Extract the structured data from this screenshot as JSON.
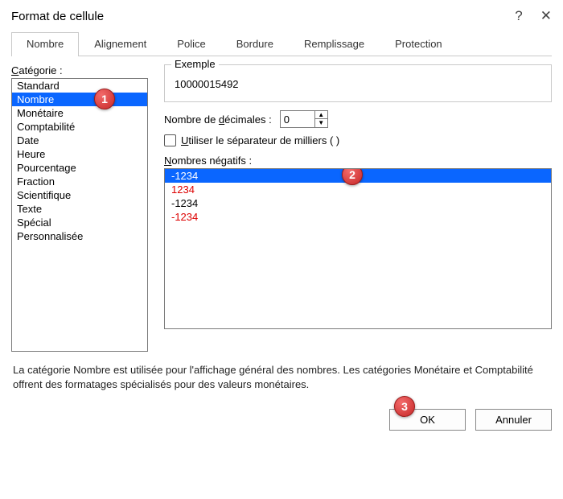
{
  "title": "Format de cellule",
  "tabs": [
    "Nombre",
    "Alignement",
    "Police",
    "Bordure",
    "Remplissage",
    "Protection"
  ],
  "activeTabIndex": 0,
  "left": {
    "label_pre": "",
    "label_underline": "C",
    "label_post": "atégorie :",
    "items": [
      "Standard",
      "Nombre",
      "Monétaire",
      "Comptabilité",
      "Date",
      "Heure",
      "Pourcentage",
      "Fraction",
      "Scientifique",
      "Texte",
      "Spécial",
      "Personnalisée"
    ],
    "selectedIndex": 1
  },
  "example": {
    "legend": "Exemple",
    "value": "10000015492"
  },
  "decimals": {
    "label_pre": "Nombre de ",
    "label_underline": "d",
    "label_post": "écimales :",
    "value": "0"
  },
  "thousands": {
    "label_underline": "U",
    "label_post": "tiliser le séparateur de milliers ( )"
  },
  "negatives": {
    "label_underline": "N",
    "label_post": "ombres négatifs :",
    "items": [
      {
        "text": "-1234",
        "color": "#000",
        "selected": true
      },
      {
        "text": "1234",
        "color": "#d00",
        "selected": false
      },
      {
        "text": "-1234",
        "color": "#000",
        "selected": false
      },
      {
        "text": "-1234",
        "color": "#d00",
        "selected": false
      }
    ]
  },
  "description": "La catégorie Nombre est utilisée pour l'affichage général des nombres. Les catégories Monétaire et Comptabilité offrent des formatages spécialisés pour des valeurs monétaires.",
  "buttons": {
    "ok": "OK",
    "cancel": "Annuler"
  },
  "callouts": {
    "one": "1",
    "two": "2",
    "three": "3"
  }
}
